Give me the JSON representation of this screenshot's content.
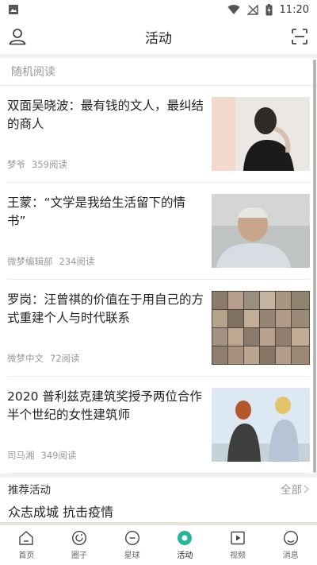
{
  "status_bar": {
    "time": "11:20"
  },
  "header": {
    "title": "活动"
  },
  "random_reading": {
    "label": "随机阅读",
    "articles": [
      {
        "title": "双面吴晓波：最有钱的文人，最纠结的商人",
        "author": "梦爷",
        "reads": "359阅读"
      },
      {
        "title": "王蒙：“文学是我给生活留下的情书”",
        "author": "微梦编辑部",
        "reads": "234阅读"
      },
      {
        "title": "罗岗：汪曾祺的价值在于用自己的方式重建个人与时代联系",
        "author": "微梦中文",
        "reads": "72阅读"
      },
      {
        "title": "2020 普利兹克建筑奖授予两位合作半个世纪的女性建筑师",
        "author": "司马湘",
        "reads": "349阅读"
      }
    ]
  },
  "recommended": {
    "label": "推荐活动",
    "more": "全部",
    "item": "众志成城 抗击疫情"
  },
  "bottom_nav": [
    {
      "label": "首页",
      "icon": "home-icon"
    },
    {
      "label": "圈子",
      "icon": "circle-icon"
    },
    {
      "label": "星球",
      "icon": "planet-icon"
    },
    {
      "label": "活动",
      "icon": "activity-icon",
      "active": true
    },
    {
      "label": "视频",
      "icon": "video-icon"
    },
    {
      "label": "消息",
      "icon": "message-icon"
    }
  ],
  "colors": {
    "accent": "#25b69a",
    "text": "#222222",
    "muted": "#999999"
  }
}
